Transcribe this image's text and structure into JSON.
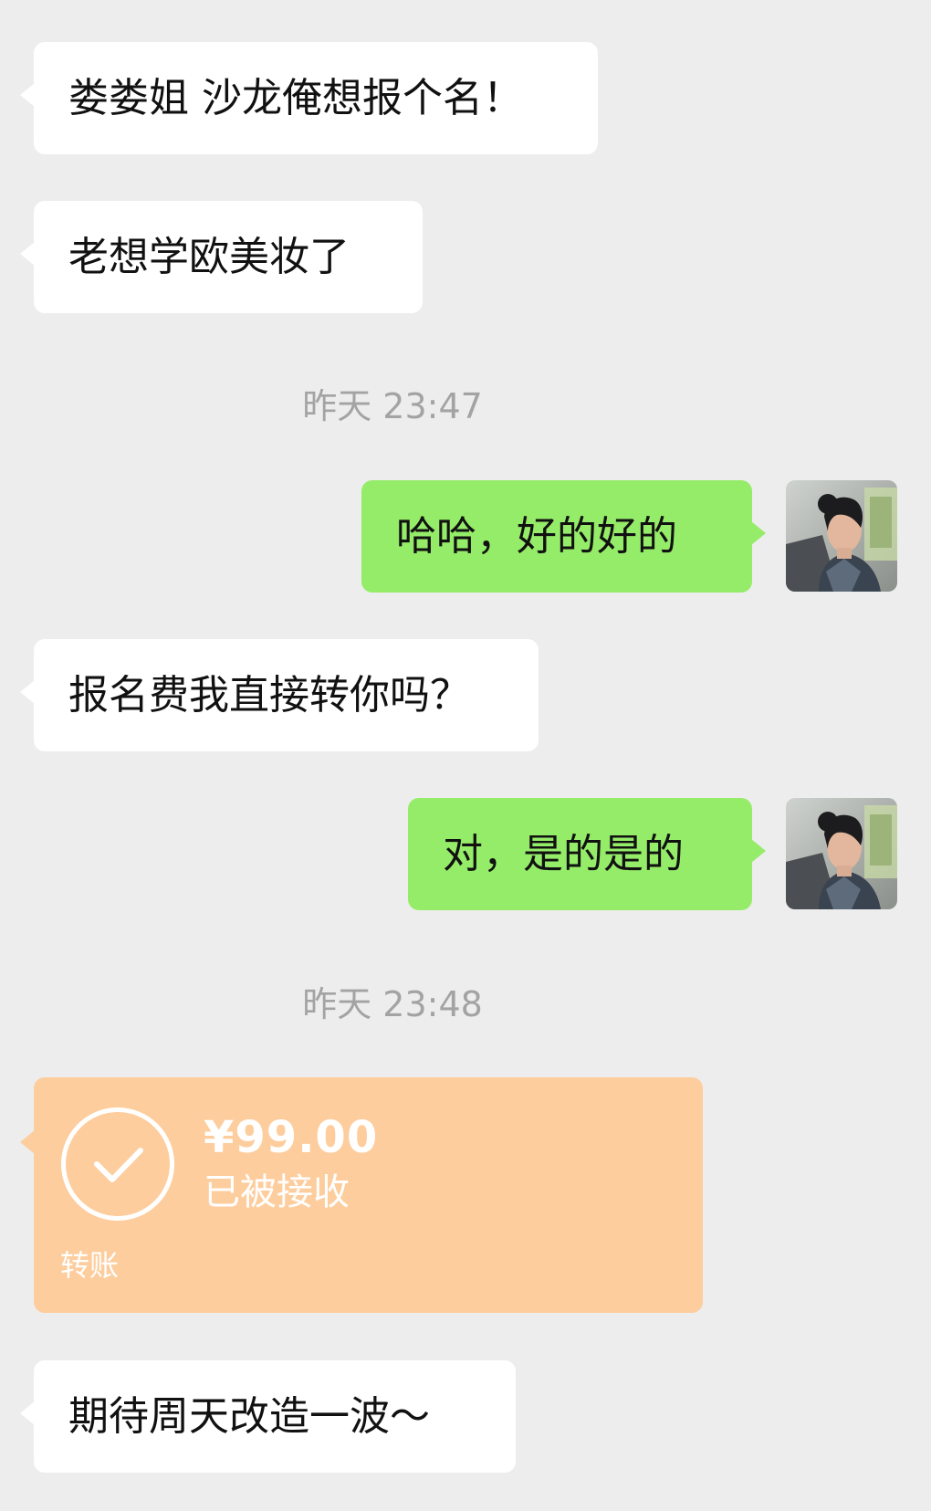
{
  "messages": [
    {
      "id": "m1",
      "side": "in",
      "text": "娄娄姐 沙龙俺想报个名！"
    },
    {
      "id": "m2",
      "side": "in",
      "text": "老想学欧美妆了"
    },
    {
      "id": "t1",
      "type": "timestamp",
      "text": "昨天 23:47"
    },
    {
      "id": "m3",
      "side": "out",
      "text": "哈哈，好的好的"
    },
    {
      "id": "m4",
      "side": "in",
      "text": "报名费我直接转你吗？"
    },
    {
      "id": "m5",
      "side": "out",
      "text": "对，是的是的"
    },
    {
      "id": "t2",
      "type": "timestamp",
      "text": "昨天 23:48"
    },
    {
      "id": "m6",
      "side": "in",
      "text": "期待周天改造一波～"
    }
  ],
  "transfer": {
    "amount": "¥99.00",
    "status": "已被接收",
    "label": "转账",
    "icon": "check-circle-icon"
  },
  "colors": {
    "background": "#ededed",
    "incoming_bubble": "#ffffff",
    "outgoing_bubble": "#95ec69",
    "transfer_card": "#fdcd9d",
    "timestamp_text": "#a3a3a3"
  }
}
